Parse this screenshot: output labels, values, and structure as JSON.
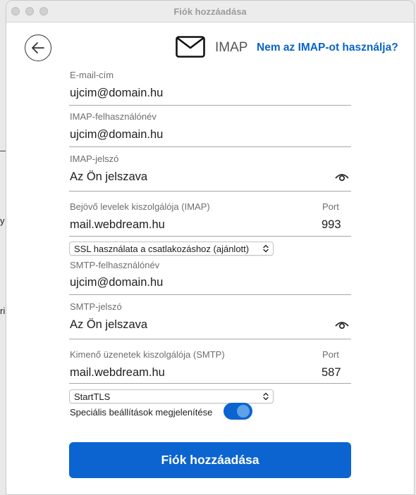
{
  "window": {
    "title": "Fiók hozzáadása"
  },
  "header": {
    "account_type": "IMAP",
    "alt_link": "Nem az IMAP-ot használja?"
  },
  "background_fragments": [
    "y",
    "ri"
  ],
  "fields": {
    "email": {
      "label": "E-mail-cím",
      "value": "ujcim@domain.hu"
    },
    "imap_user": {
      "label": "IMAP-felhasználónév",
      "value": "ujcim@domain.hu"
    },
    "imap_password": {
      "label": "IMAP-jelszó",
      "placeholder": "Az Ön jelszava"
    },
    "incoming_server": {
      "label": "Bejövő levelek kiszolgálója (IMAP)",
      "value": "mail.webdream.hu",
      "port_label": "Port",
      "port": "993"
    },
    "incoming_security": {
      "selected": "SSL használata a csatlakozáshoz (ajánlott)"
    },
    "smtp_user": {
      "label": "SMTP-felhasználónév",
      "value": "ujcim@domain.hu"
    },
    "smtp_password": {
      "label": "SMTP-jelszó",
      "placeholder": "Az Ön jelszava"
    },
    "outgoing_server": {
      "label": "Kimenő üzenetek kiszolgálója (SMTP)",
      "value": "mail.webdream.hu",
      "port_label": "Port",
      "port": "587"
    },
    "outgoing_security": {
      "selected": "StartTLS"
    }
  },
  "advanced": {
    "label": "Speciális beállítások megjelenítése",
    "enabled": true
  },
  "submit_label": "Fiók hozzáadása",
  "colors": {
    "accent": "#0b64cf",
    "link": "#0a64c8"
  }
}
